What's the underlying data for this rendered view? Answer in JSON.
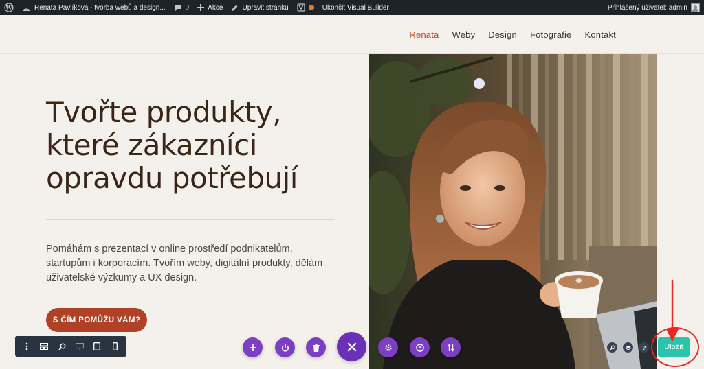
{
  "adminbar": {
    "site_name": "Renata Pavlíková - tvorba webů a design...",
    "comments_count": "0",
    "new_label": "Akce",
    "edit_label": "Upravit stránku",
    "exit_vb_label": "Ukončit Visual Builder",
    "account_label": "Přihlášený uživatel: admin"
  },
  "nav": {
    "items": [
      "Renata",
      "Weby",
      "Design",
      "Fotografie",
      "Kontakt"
    ],
    "active": "Renata"
  },
  "hero": {
    "title_lines": [
      "Tvořte produkty,",
      "které zákazníci",
      "opravdu potřebují"
    ],
    "description": "Pomáhám s prezentací v online prostředí podnikatelům, startupům i korporacím. Tvořím weby, digitální produkty, dělám uživatelské výzkumy a UX design.",
    "cta_label": "S ČÍM POMŮŽU VÁM?"
  },
  "builder": {
    "save_label": "Uložit"
  },
  "colors": {
    "accent": "#c0472d",
    "cta": "#b04127",
    "builder_purple": "#7c3fc4",
    "save": "#29c4a9",
    "annotation": "#e8271f"
  }
}
